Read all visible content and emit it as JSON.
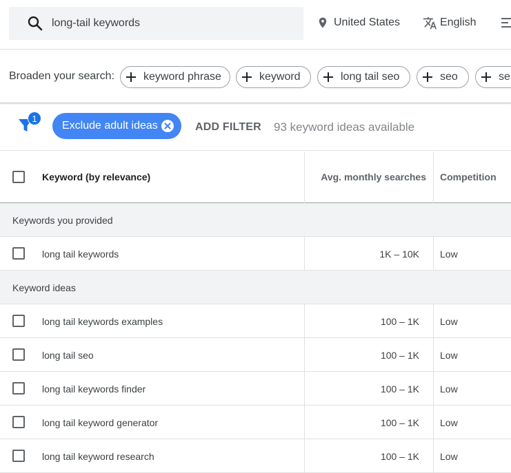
{
  "search": {
    "value": "long-tail keywords"
  },
  "location": "United States",
  "language": "English",
  "broaden": {
    "label": "Broaden your search:",
    "chips": [
      "keyword phrase",
      "keyword",
      "long tail seo",
      "seo",
      "se"
    ]
  },
  "filters": {
    "badge": "1",
    "active_filter": "Exclude adult ideas",
    "add_filter": "ADD FILTER",
    "count_text": "93 keyword ideas available"
  },
  "table": {
    "headers": {
      "keyword": "Keyword (by relevance)",
      "avg": "Avg. monthly searches",
      "competition": "Competition"
    },
    "sections": [
      {
        "title": "Keywords you provided",
        "rows": [
          {
            "keyword": "long tail keywords",
            "avg": "1K – 10K",
            "competition": "Low"
          }
        ]
      },
      {
        "title": "Keyword ideas",
        "rows": [
          {
            "keyword": "long tail keywords examples",
            "avg": "100 – 1K",
            "competition": "Low"
          },
          {
            "keyword": "long tail seo",
            "avg": "100 – 1K",
            "competition": "Low"
          },
          {
            "keyword": "long tail keywords finder",
            "avg": "100 – 1K",
            "competition": "Low"
          },
          {
            "keyword": "long tail keyword generator",
            "avg": "100 – 1K",
            "competition": "Low"
          },
          {
            "keyword": "long tail keyword research",
            "avg": "100 – 1K",
            "competition": "Low"
          }
        ]
      }
    ]
  },
  "colors": {
    "accent": "#1a73e8",
    "pill": "#4285f4"
  }
}
